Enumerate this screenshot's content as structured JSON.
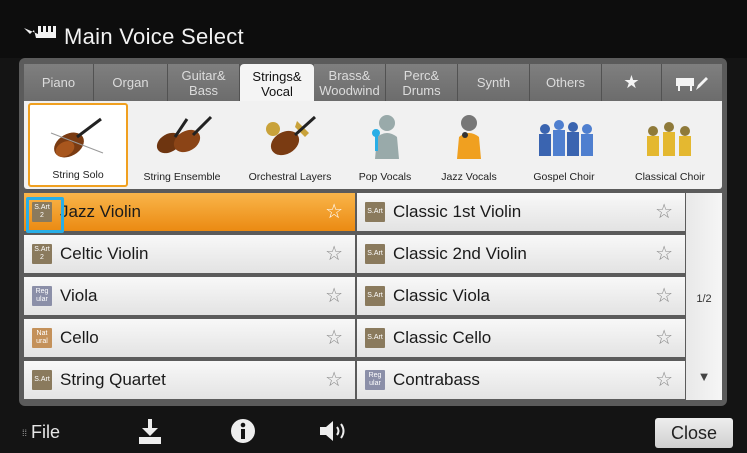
{
  "header": {
    "title": "Main Voice Select",
    "icon": "keyboard-icon"
  },
  "tabs": [
    {
      "label": "Piano"
    },
    {
      "label": "Organ"
    },
    {
      "label": "Guitar& Bass"
    },
    {
      "label": "Strings& Vocal",
      "active": true
    },
    {
      "label": "Brass& Woodwind"
    },
    {
      "label": "Perc& Drums"
    },
    {
      "label": "Synth"
    },
    {
      "label": "Others"
    },
    {
      "label": "★",
      "icon": "favorite-star-icon"
    },
    {
      "label": "",
      "icon": "keyboard-edit-icon"
    }
  ],
  "categories": [
    {
      "label": "String Solo",
      "selected": true
    },
    {
      "label": "String Ensemble"
    },
    {
      "label": "Orchestral Layers"
    },
    {
      "label": "Pop Vocals"
    },
    {
      "label": "Jazz Vocals"
    },
    {
      "label": "Gospel Choir"
    },
    {
      "label": "Classical Choir"
    }
  ],
  "voices_left": [
    {
      "badge": "S.Art 2",
      "name": "Jazz Violin",
      "selected": true
    },
    {
      "badge": "S.Art 2",
      "name": "Celtic Violin"
    },
    {
      "badge": "Regular",
      "name": "Viola"
    },
    {
      "badge": "Natural",
      "name": "Cello"
    },
    {
      "badge": "S.Art",
      "name": "String Quartet"
    }
  ],
  "voices_right": [
    {
      "badge": "S.Art",
      "name": "Classic 1st Violin"
    },
    {
      "badge": "S.Art",
      "name": "Classic 2nd Violin"
    },
    {
      "badge": "S.Art",
      "name": "Classic Viola"
    },
    {
      "badge": "S.Art",
      "name": "Classic Cello"
    },
    {
      "badge": "Regular",
      "name": "Contrabass"
    }
  ],
  "badges": {
    "sart2_top": "S.Art",
    "sart2_bottom": "2",
    "reg_top": "Reg",
    "reg_bottom": "ular",
    "nat_top": "Nat",
    "nat_bottom": "ural",
    "sart": "S.Art"
  },
  "pager": {
    "page": "1/2",
    "down": "▼",
    "star": "☆"
  },
  "bottom": {
    "file": "File",
    "close": "Close",
    "dots": "⁞⁞"
  },
  "colors": {
    "accent": "#f0a020",
    "cursor": "#29aee6"
  }
}
